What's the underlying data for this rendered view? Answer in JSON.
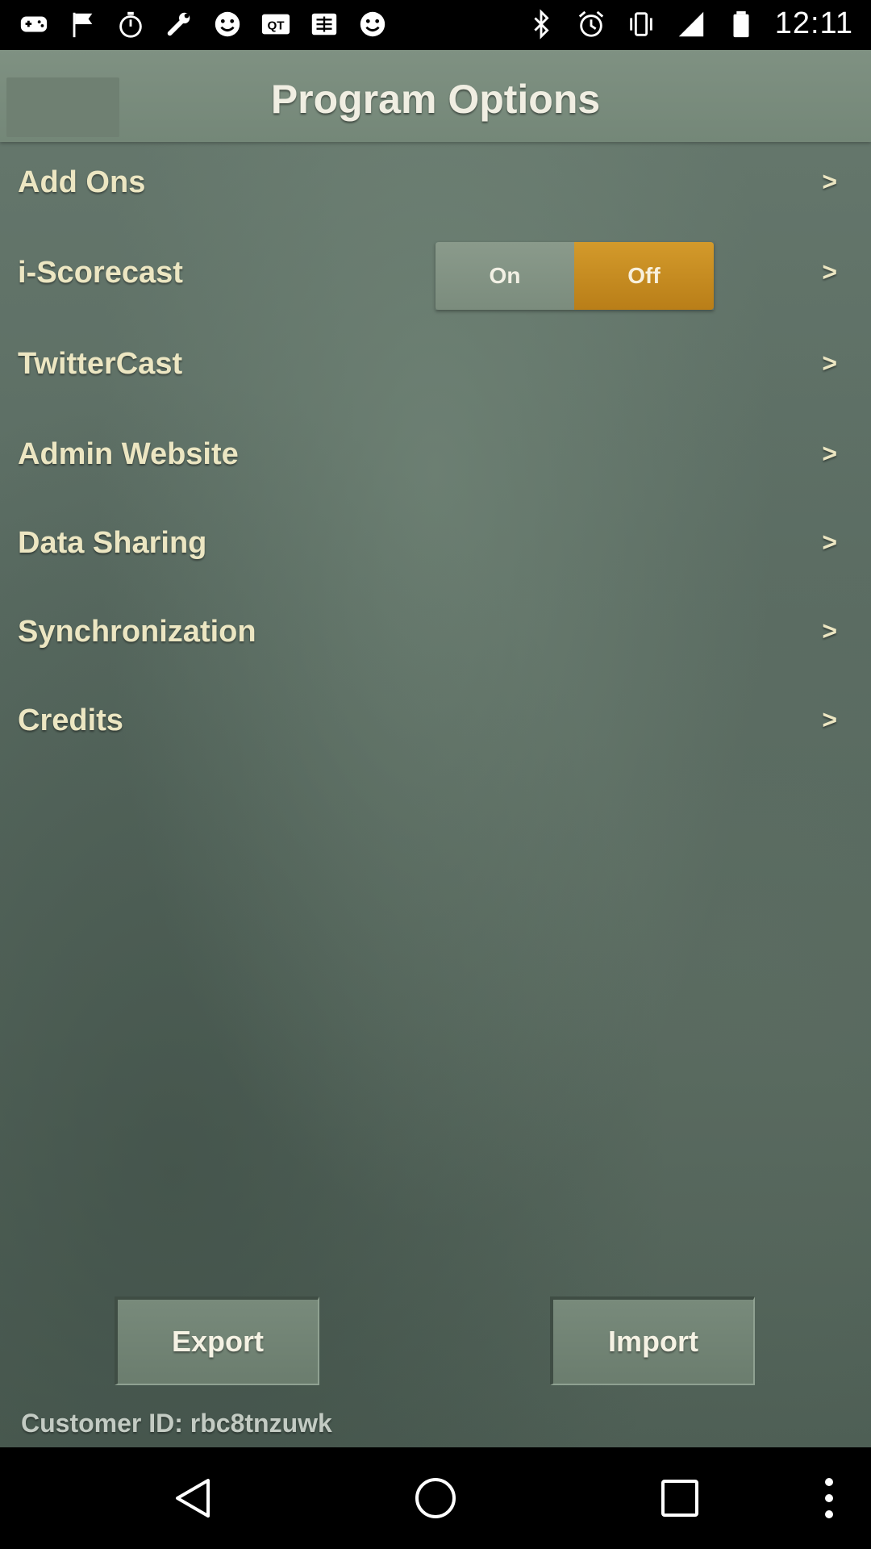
{
  "status_bar": {
    "left_icons": [
      "gamepad-icon",
      "flag-icon",
      "stopwatch-icon",
      "wrench-icon",
      "smiley-icon",
      "qt-icon",
      "chinese-app-icon",
      "smiley-icon"
    ],
    "qt_label": "QT",
    "right_icons": [
      "bluetooth-icon",
      "alarm-icon",
      "vibrate-icon",
      "signal-icon",
      "battery-icon"
    ],
    "time": "12:11"
  },
  "header": {
    "title": "Program Options"
  },
  "menu": {
    "items": [
      {
        "label": "Add Ons",
        "chevron": ">"
      },
      {
        "label": "i-Scorecast",
        "chevron": ">"
      },
      {
        "label": "TwitterCast",
        "chevron": ">"
      },
      {
        "label": "Admin Website",
        "chevron": ">"
      },
      {
        "label": "Data Sharing",
        "chevron": ">"
      },
      {
        "label": "Synchronization",
        "chevron": ">"
      },
      {
        "label": "Credits",
        "chevron": ">"
      }
    ]
  },
  "toggle": {
    "on_label": "On",
    "off_label": "Off",
    "selected": "Off",
    "selected_color": "#c98c22"
  },
  "footer": {
    "export_label": "Export",
    "import_label": "Import",
    "customer_id": "Customer ID: rbc8tnzuwk"
  },
  "nav_bar": {
    "icons": [
      "back-icon",
      "home-icon",
      "recent-apps-icon",
      "overflow-menu-icon"
    ]
  }
}
